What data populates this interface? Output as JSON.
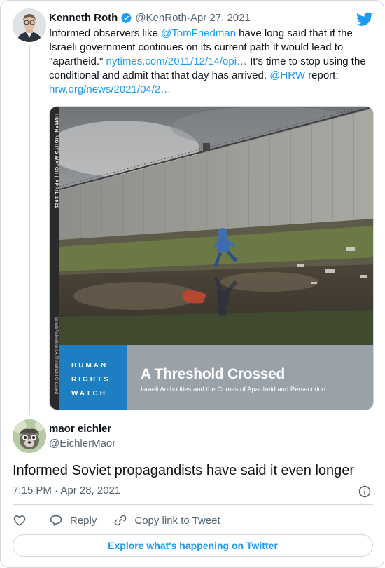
{
  "parent_tweet": {
    "author_name": "Kenneth Roth",
    "verified": true,
    "handle": "@KenRoth",
    "separator": " · ",
    "date": "Apr 27, 2021",
    "text_parts": [
      {
        "text": "Informed observers like ",
        "link": false
      },
      {
        "text": "@TomFriedman",
        "link": true
      },
      {
        "text": " have long said that if the Israeli government continues on its current path it would lead to \"apartheid.\" ",
        "link": false
      },
      {
        "text": "nytimes.com/2011/12/14/opi…",
        "link": true
      },
      {
        "text": " It's time to stop using the conditional and admit that that day has arrived. ",
        "link": false
      },
      {
        "text": "@HRW",
        "link": true
      },
      {
        "text": " report: ",
        "link": false
      },
      {
        "text": "hrw.org/news/2021/04/2…",
        "link": true
      }
    ],
    "media": {
      "spine_top": "HUMAN RIGHTS WATCH  |  APRIL 2021",
      "spine_bottom": "Israel/Palestine  |  A Threshold Crossed",
      "org_lines": [
        "HUMAN",
        "RIGHTS",
        "WATCH"
      ],
      "report_title": "A Threshold Crossed",
      "report_subtitle": "Israeli Authorities and the Crimes of Apartheid and Persecution"
    }
  },
  "reply_tweet": {
    "author_name": "maor eichler",
    "handle": "@EichlerMaor",
    "text": "Informed Soviet propagandists have said it even longer",
    "timestamp": "7:15 PM · Apr 28, 2021"
  },
  "actions": {
    "reply_label": "Reply",
    "copy_link_label": "Copy link to Tweet"
  },
  "explore_label": "Explore what's happening on Twitter",
  "colors": {
    "link": "#1d9bf0",
    "secondary_text": "#536471",
    "border": "#cfd9de",
    "hrw_blue": "#1d7fc1"
  }
}
